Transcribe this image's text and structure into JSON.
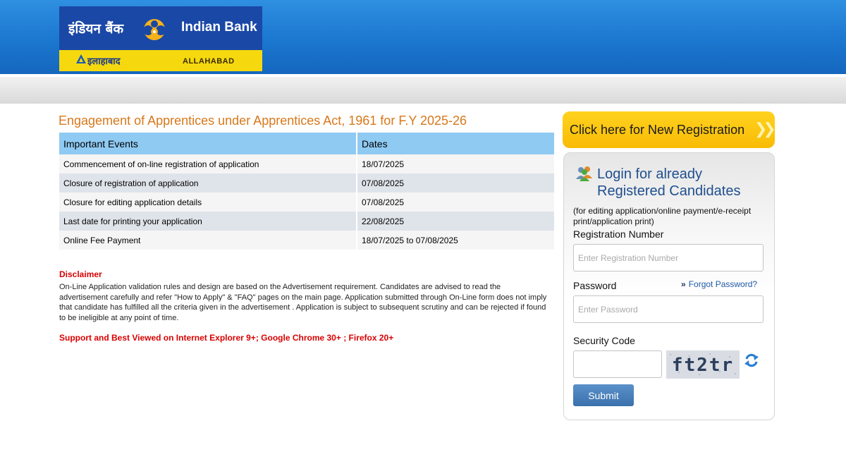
{
  "header": {
    "logo_hindi": "इंडियन बैंक",
    "logo_english": "Indian Bank",
    "logo_sub_hindi": "इलाहाबाद",
    "logo_sub_english": "ALLAHABAD"
  },
  "main": {
    "title": "Engagement of Apprentices under Apprentices Act, 1961 for F.Y 2025-26",
    "table": {
      "headers": [
        "Important Events",
        "Dates"
      ],
      "rows": [
        {
          "event": "Commencement of on-line registration of application",
          "date": "18/07/2025"
        },
        {
          "event": "Closure of registration of application",
          "date": "07/08/2025"
        },
        {
          "event": "Closure for editing application details",
          "date": "07/08/2025"
        },
        {
          "event": "Last date for printing your application",
          "date": "22/08/2025"
        },
        {
          "event": "Online Fee Payment",
          "date": "18/07/2025 to 07/08/2025"
        }
      ]
    },
    "disclaimer_title": "Disclaimer",
    "disclaimer_text": "On-Line Application validation rules and design are based on the Advertisement requirement. Candidates are advised to read the advertisement carefully and refer \"How to Apply\" & \"FAQ\" pages on the main page. Application submitted through On-Line form does not imply that candidate has fulfilled all the criteria given in the advertisement . Application is subject to subsequent scrutiny and can be rejected if found to be ineligible at any point of time.",
    "support_note": "Support and Best Viewed on Internet Explorer 9+; Google Chrome 30+ ; Firefox 20+"
  },
  "sidebar": {
    "new_registration_label": "Click here for New Registration",
    "login_title": "Login for already Registered Candidates",
    "login_note": "(for editing application/online payment/e-receipt print/application print)",
    "registration_label": "Registration Number",
    "registration_placeholder": "Enter Registration Number",
    "password_label": "Password",
    "password_placeholder": "Enter Password",
    "forgot_arrows": "»",
    "forgot_label": "Forgot Password?",
    "security_label": "Security Code",
    "captcha_text": "ft2tr",
    "submit_label": "Submit"
  },
  "colors": {
    "header_blue": "#1b77cf",
    "title_orange": "#d8781a",
    "table_header": "#8fcaf3",
    "new_registration_yellow": "#f9bb05",
    "alert_red": "#d80000",
    "submit_blue": "#3a70ac"
  },
  "icons": {
    "logo_emblem": "indian-bank-emblem-icon",
    "new_registration_chevron": "double-chevron-right-icon",
    "login_users": "users-icon",
    "refresh_captcha": "refresh-icon"
  }
}
